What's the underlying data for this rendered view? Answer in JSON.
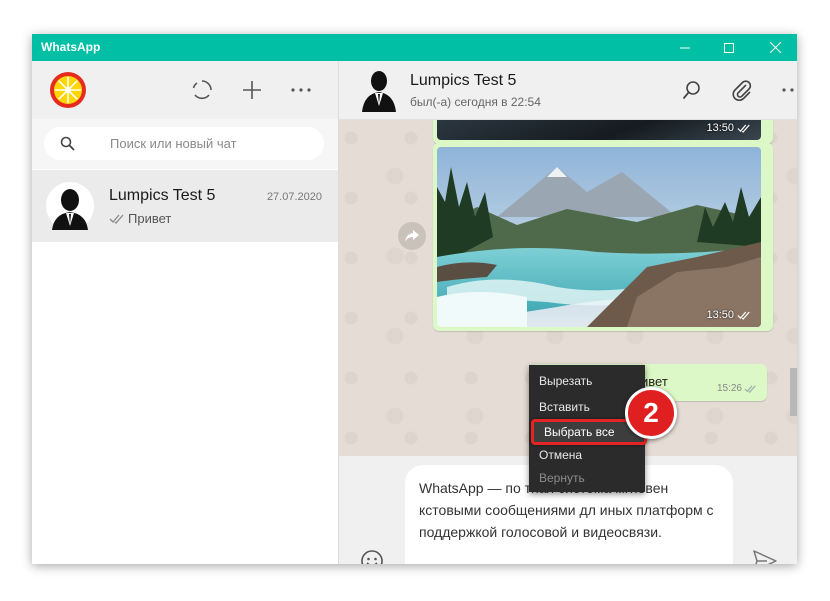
{
  "window": {
    "title": "WhatsApp",
    "minimize_icon": "minimize-icon",
    "maximize_icon": "maximize-icon",
    "close_icon": "close-icon"
  },
  "sidebar": {
    "profile_icon": "lemon-avatar",
    "status_icon": "status-icon",
    "new_chat_icon": "plus-icon",
    "menu_icon": "more-icon",
    "search": {
      "placeholder": "Поиск или новый чат",
      "icon": "search-icon"
    },
    "chats": [
      {
        "name": "Lumpics Test 5",
        "date": "27.07.2020",
        "preview": "Привет"
      }
    ]
  },
  "conversation": {
    "contact_name": "Lumpics Test 5",
    "status": "был(-а) сегодня в 22:54",
    "messages": [
      {
        "type": "image",
        "time": "13:50"
      },
      {
        "type": "image",
        "time": "13:50"
      },
      {
        "type": "text",
        "text": "ивет",
        "time": "15:26"
      }
    ],
    "composer_text": "WhatsApp — популярная бесплатная система мгновенного обмена текстовыми сообщениями для мобильных и иных платформ с поддержкой голосовой и видеосвязи.",
    "composer_visible": "WhatsApp — по          тная система мгновен          кстовыми сообщениями дл          иных платформ с поддержкой голосовой и видеосвязи."
  },
  "context_menu": {
    "items": [
      {
        "label": "Вырезать",
        "enabled": true
      },
      {
        "label": "Вставить",
        "enabled": true
      },
      {
        "label": "Выбрать все",
        "enabled": true,
        "highlighted": true
      },
      {
        "label": "Отмена",
        "enabled": true
      },
      {
        "label": "Вернуть",
        "enabled": false
      }
    ]
  },
  "annotation": {
    "step": "2",
    "color": "#e02020"
  },
  "colors": {
    "brand": "#00bfa5",
    "bubble": "#dcf8c6",
    "wallpaper": "#e5ddd5"
  }
}
